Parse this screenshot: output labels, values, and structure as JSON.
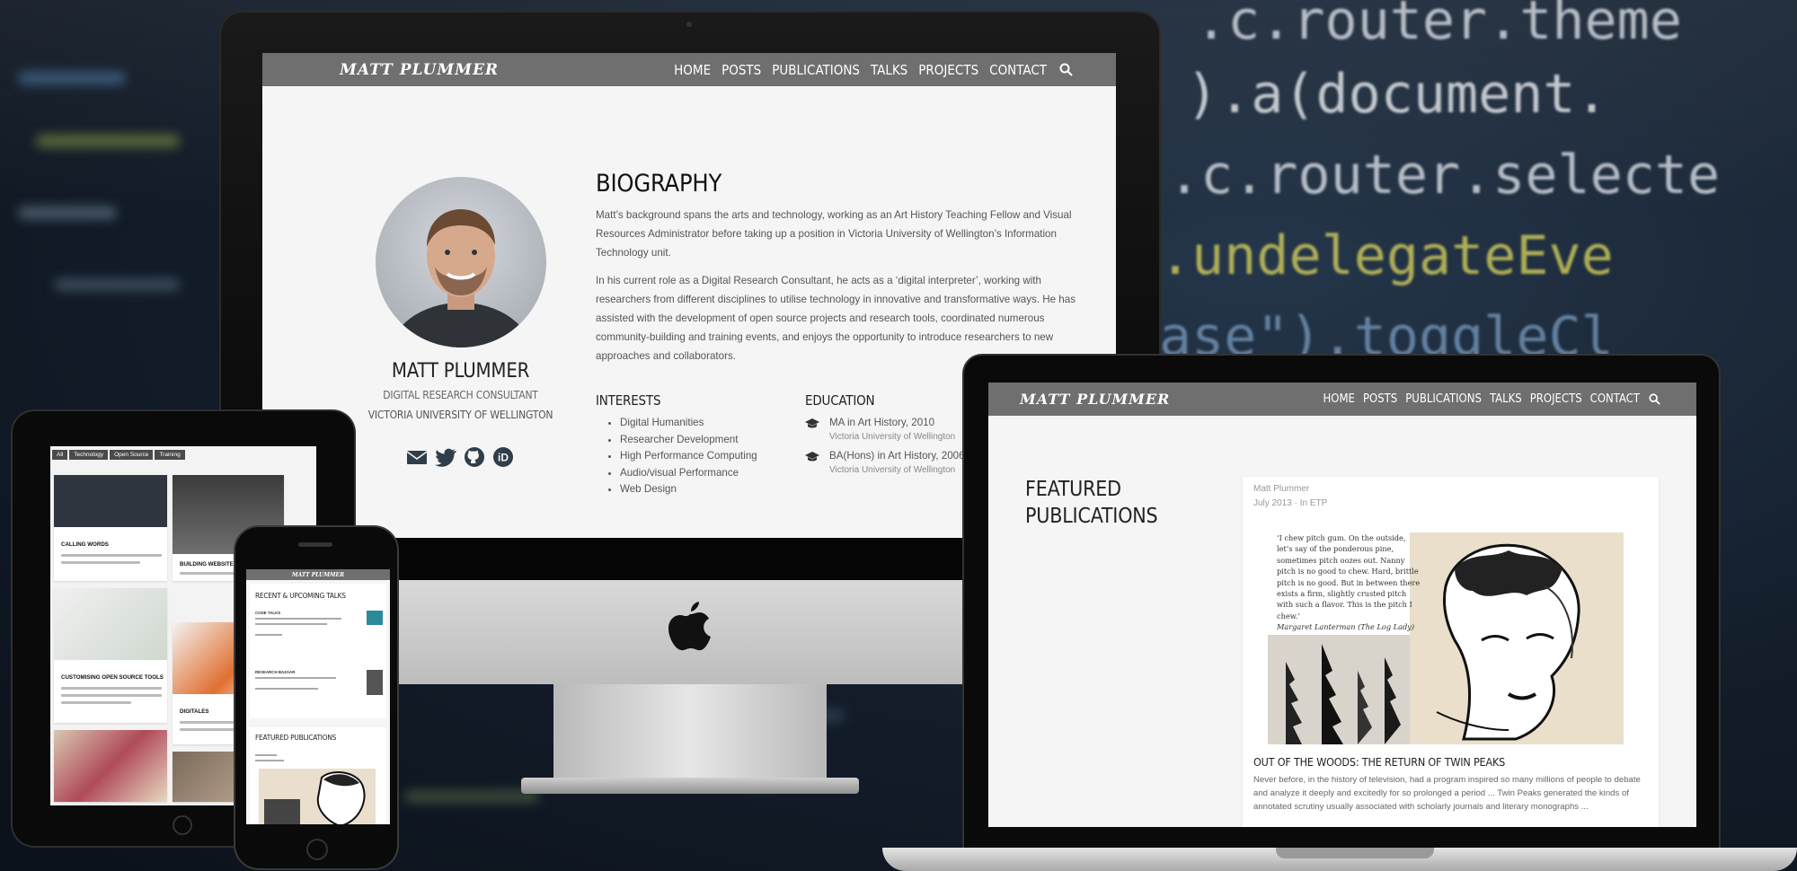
{
  "background": {
    "code_lines": [
      ".c.router.theme",
      ").a(document.",
      ".c.router.selecte",
      ".undelegateEve",
      "ase\").toggleCl"
    ]
  },
  "desktop": {
    "nav": {
      "brand": "MATT PLUMMER",
      "items": [
        "HOME",
        "POSTS",
        "PUBLICATIONS",
        "TALKS",
        "PROJECTS",
        "CONTACT"
      ],
      "search_icon": "search-icon"
    },
    "profile": {
      "name": "MATT PLUMMER",
      "title": "DIGITAL RESEARCH CONSULTANT",
      "organization": "VICTORIA UNIVERSITY OF WELLINGTON",
      "social_icons": [
        "envelope-icon",
        "twitter-icon",
        "github-icon",
        "orcid-icon"
      ]
    },
    "biography": {
      "heading": "BIOGRAPHY",
      "paragraph1": "Matt’s background spans the arts and technology, working as an Art History Teaching Fellow and Visual Resources Administrator before taking up a position in Victoria University of Wellington’s Information Technology unit.",
      "paragraph2": "In his current role as a Digital Research Consultant, he acts as a ‘digital interpreter’, working with researchers from different disciplines to utilise technology in innovative and transformative ways. He has assisted with the development of open source projects and research tools, coordinated numerous community-building and training events, and enjoys the opportunity to introduce researchers to new approaches and collaborators."
    },
    "interests": {
      "heading": "INTERESTS",
      "items": [
        "Digital Humanities",
        "Researcher Development",
        "High Performance Computing",
        "Audio/visual Performance",
        "Web Design"
      ]
    },
    "education": {
      "heading": "EDUCATION",
      "items": [
        {
          "degree": "MA in Art History, 2010",
          "institution": "Victoria University of Wellington"
        },
        {
          "degree": "BA(Hons) in Art History, 2006",
          "institution": "Victoria University of Wellington"
        }
      ]
    }
  },
  "laptop": {
    "nav": {
      "brand": "MATT PLUMMER",
      "items": [
        "HOME",
        "POSTS",
        "PUBLICATIONS",
        "TALKS",
        "PROJECTS",
        "CONTACT"
      ]
    },
    "featured": {
      "heading": "FEATURED PUBLICATIONS",
      "author": "Matt Plummer",
      "meta": "July 2013 · In ETP",
      "quote": "‘I chew pitch gum. On the outside, let’s say of the ponderous pine, sometimes pitch oozes out. Nanny pitch is no good to chew. Hard, brittle pitch is no good. But in between there exists a firm, slightly crusted pitch with such a flavor. This is the pitch I chew.’",
      "quote_attribution": "Margaret Lanterman (The Log Lady)",
      "title": "OUT OF THE WOODS: THE RETURN OF TWIN PEAKS",
      "excerpt": "Never before, in the history of television, had a program inspired so many millions of people to debate and analyze it deeply and excitedly for so prolonged a period ... Twin Peaks generated the kinds of annotated scrutiny usually associated with scholarly journals and literary monographs ..."
    }
  },
  "tablet": {
    "filters": [
      "All",
      "Technology",
      "Open Source",
      "Training"
    ],
    "cards": [
      "CALLING WORDS",
      "BUILDING WEBSITES",
      "CUSTOMISING OPEN SOURCE TOOLS",
      "DIGITALES"
    ]
  },
  "phone": {
    "brand": "MATT PLUMMER",
    "talks_heading": "RECENT & UPCOMING TALKS",
    "talk1": "CODE TALKS",
    "talk2": "RESEARCH BAZAAR",
    "publications_heading": "FEATURED PUBLICATIONS"
  },
  "colors": {
    "nav_bg": "#6f6f6f",
    "page_bg": "#f5f5f5",
    "code_yellow": "#c8c45a",
    "code_white": "#e8e8e8"
  }
}
